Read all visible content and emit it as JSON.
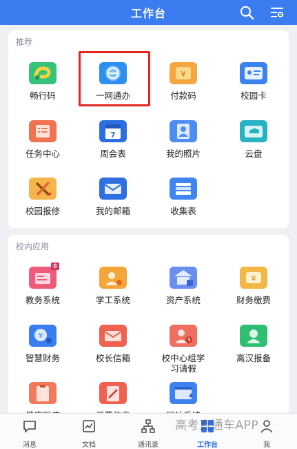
{
  "header": {
    "title": "工作台",
    "search_icon": "search-icon",
    "settings_icon": "filter-settings-icon"
  },
  "recommend": {
    "title": "推荐",
    "apps": [
      {
        "label": "畅行码",
        "icon": "green-pass-icon"
      },
      {
        "label": "一网通办",
        "icon": "e-service-icon"
      },
      {
        "label": "付款码",
        "icon": "payment-code-icon"
      },
      {
        "label": "校园卡",
        "icon": "campus-card-icon"
      },
      {
        "label": "任务中心",
        "icon": "task-center-icon"
      },
      {
        "label": "周会表",
        "icon": "calendar-icon"
      },
      {
        "label": "我的照片",
        "icon": "photo-id-icon"
      },
      {
        "label": "云盘",
        "icon": "cloud-drive-icon"
      },
      {
        "label": "校园报修",
        "icon": "repair-tools-icon"
      },
      {
        "label": "我的邮箱",
        "icon": "mailbox-icon"
      },
      {
        "label": "收集表",
        "icon": "collection-form-icon"
      }
    ]
  },
  "campus": {
    "title": "校内应用",
    "apps": [
      {
        "label": "教务系统",
        "icon": "academic-system-icon",
        "badge": "本"
      },
      {
        "label": "学工系统",
        "icon": "student-affairs-icon"
      },
      {
        "label": "资产系统",
        "icon": "asset-system-icon"
      },
      {
        "label": "财务缴费",
        "icon": "finance-payment-icon"
      },
      {
        "label": "智慧财务",
        "icon": "smart-finance-icon"
      },
      {
        "label": "校长信箱",
        "icon": "president-mailbox-icon"
      },
      {
        "label": "校中心组学习请假",
        "line1": "校中心组学",
        "line2": "习请假",
        "icon": "leave-request-icon"
      },
      {
        "label": "离汉报备",
        "icon": "departure-report-icon"
      },
      {
        "label": "健康医疗",
        "icon": "health-icon"
      },
      {
        "label": "开票信息",
        "icon": "invoice-icon"
      },
      {
        "label": "网站系统",
        "icon": "website-system-icon"
      }
    ]
  },
  "tabbar": [
    {
      "label": "消息",
      "icon": "message-icon"
    },
    {
      "label": "文档",
      "icon": "document-icon"
    },
    {
      "label": "通讯录",
      "icon": "contacts-icon"
    },
    {
      "label": "工作台",
      "icon": "workbench-icon",
      "active": true
    },
    {
      "label": "我",
      "icon": "profile-icon"
    }
  ],
  "watermark": "高考直通车APP",
  "colors": {
    "header": "#3b7cf0",
    "highlight": "#e3241f",
    "active_tab": "#2f6fe8"
  }
}
